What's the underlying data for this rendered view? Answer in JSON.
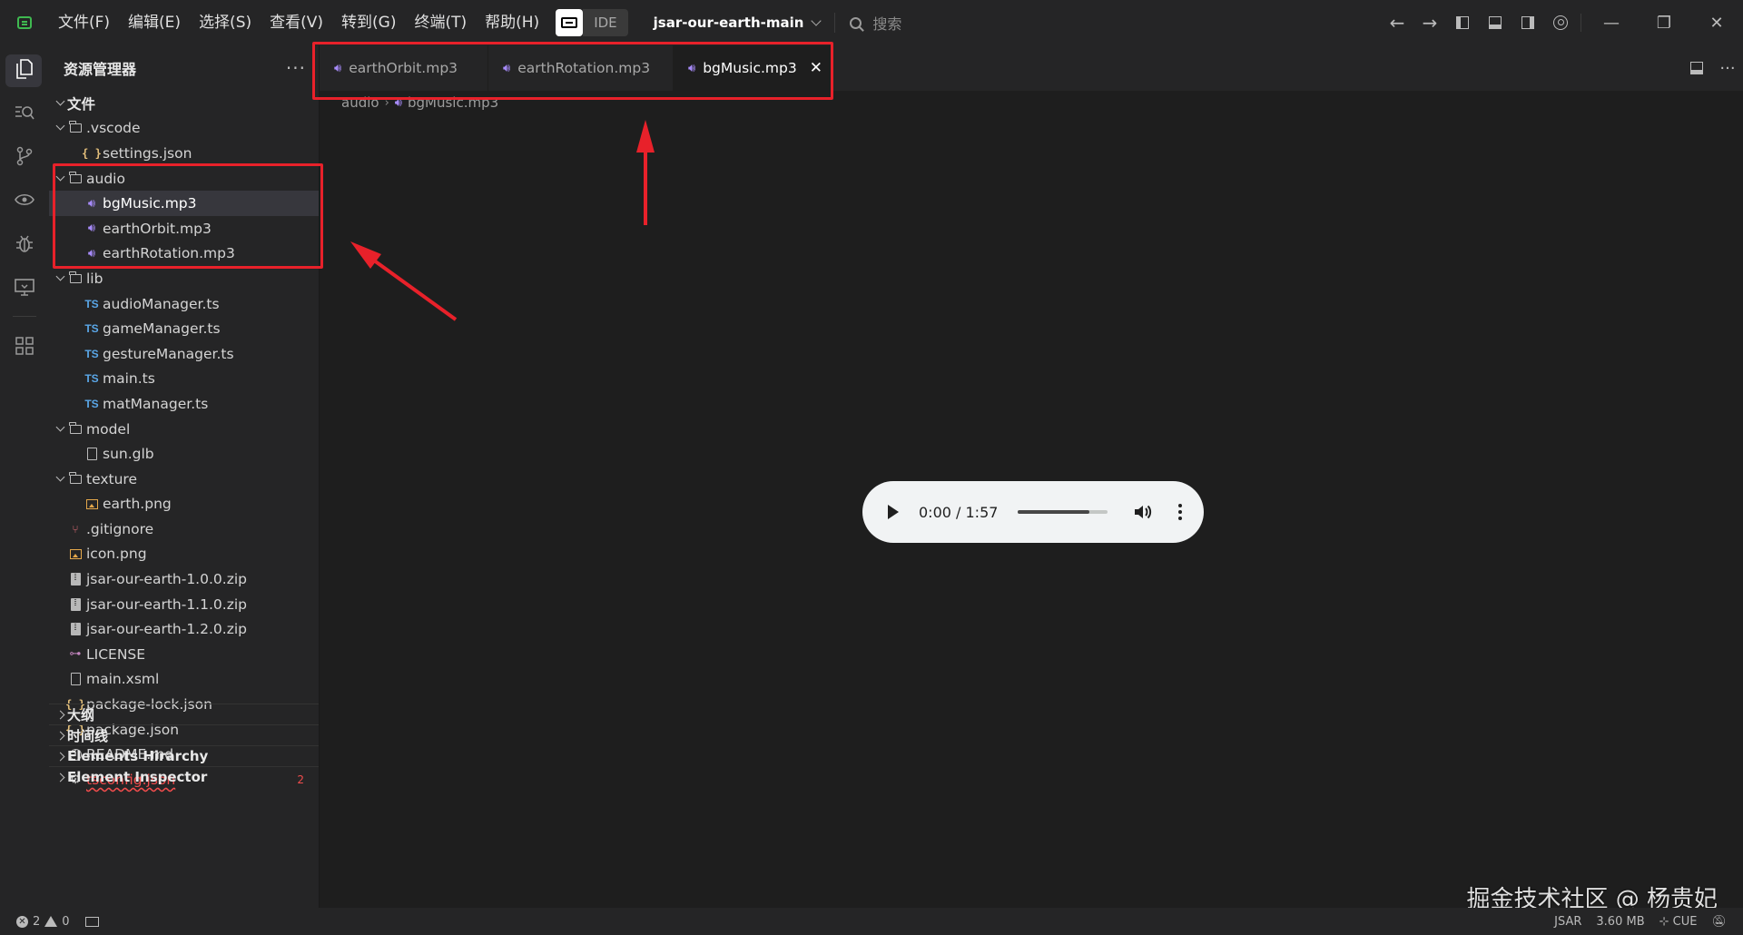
{
  "menu": [
    "文件(F)",
    "编辑(E)",
    "选择(S)",
    "查看(V)",
    "转到(G)",
    "终端(T)",
    "帮助(H)"
  ],
  "ide_label": "IDE",
  "project_name": "jsar-our-earth-main",
  "search_placeholder": "搜索",
  "sidebar": {
    "title": "资源管理器",
    "more": "···",
    "root_section": "文件",
    "items": [
      {
        "label": ".vscode",
        "type": "folder",
        "depth": 0,
        "expanded": true
      },
      {
        "label": "settings.json",
        "type": "json",
        "depth": 1
      },
      {
        "label": "audio",
        "type": "folder",
        "depth": 0,
        "expanded": true
      },
      {
        "label": "bgMusic.mp3",
        "type": "audio",
        "depth": 1,
        "selected": true
      },
      {
        "label": "earthOrbit.mp3",
        "type": "audio",
        "depth": 1
      },
      {
        "label": "earthRotation.mp3",
        "type": "audio",
        "depth": 1
      },
      {
        "label": "lib",
        "type": "folder",
        "depth": 0,
        "expanded": true
      },
      {
        "label": "audioManager.ts",
        "type": "ts",
        "depth": 1
      },
      {
        "label": "gameManager.ts",
        "type": "ts",
        "depth": 1
      },
      {
        "label": "gestureManager.ts",
        "type": "ts",
        "depth": 1
      },
      {
        "label": "main.ts",
        "type": "ts",
        "depth": 1
      },
      {
        "label": "matManager.ts",
        "type": "ts",
        "depth": 1
      },
      {
        "label": "model",
        "type": "folder",
        "depth": 0,
        "expanded": true
      },
      {
        "label": "sun.glb",
        "type": "file",
        "depth": 1
      },
      {
        "label": "texture",
        "type": "folder",
        "depth": 0,
        "expanded": true
      },
      {
        "label": "earth.png",
        "type": "image",
        "depth": 1
      },
      {
        "label": ".gitignore",
        "type": "git",
        "depth": 0
      },
      {
        "label": "icon.png",
        "type": "image",
        "depth": 0
      },
      {
        "label": "jsar-our-earth-1.0.0.zip",
        "type": "zip",
        "depth": 0
      },
      {
        "label": "jsar-our-earth-1.1.0.zip",
        "type": "zip",
        "depth": 0
      },
      {
        "label": "jsar-our-earth-1.2.0.zip",
        "type": "zip",
        "depth": 0
      },
      {
        "label": "LICENSE",
        "type": "license",
        "depth": 0
      },
      {
        "label": "main.xsml",
        "type": "file",
        "depth": 0
      },
      {
        "label": "package-lock.json",
        "type": "json",
        "depth": 0
      },
      {
        "label": "package.json",
        "type": "json",
        "depth": 0
      },
      {
        "label": "README.md",
        "type": "info",
        "depth": 0
      },
      {
        "label": "tsconfig.json",
        "type": "gear",
        "depth": 0,
        "error": true,
        "badge": "2"
      }
    ],
    "panels": [
      "大纲",
      "时间线",
      "Elements Hirarchy",
      "Element Inspector"
    ]
  },
  "tabs": [
    {
      "label": "earthOrbit.mp3",
      "active": false
    },
    {
      "label": "earthRotation.mp3",
      "active": false
    },
    {
      "label": "bgMusic.mp3",
      "active": true
    }
  ],
  "tab_close": "✕",
  "breadcrumb": {
    "folder": "audio",
    "file": "bgMusic.mp3",
    "sep": "›"
  },
  "audio_player": {
    "time": "0:00 / 1:57",
    "volume_level": 0.8
  },
  "watermark": "掘金技术社区 @ 杨贵妃",
  "status": {
    "errors": "2",
    "warnings": "0",
    "right": [
      "JSAR",
      "3.60 MB",
      "CUE"
    ]
  },
  "colors": {
    "annotation_red": "#e8212a",
    "audio_icon": "#a78bfa",
    "ts_icon": "#5aa7e8",
    "error": "#f14c4c"
  }
}
